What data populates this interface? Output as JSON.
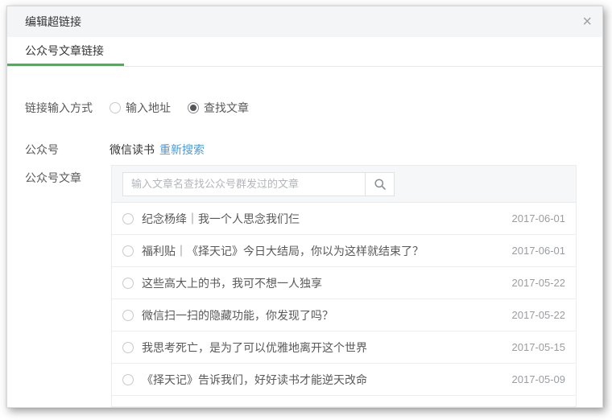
{
  "dialog": {
    "title": "编辑超链接",
    "close_icon": "×"
  },
  "tabs": {
    "article_link": "公众号文章链接"
  },
  "form": {
    "method": {
      "label": "链接输入方式",
      "options": [
        {
          "label": "输入地址",
          "selected": false
        },
        {
          "label": "查找文章",
          "selected": true
        }
      ]
    },
    "account": {
      "label": "公众号",
      "value": "微信读书",
      "research_link": "重新搜索"
    },
    "articles": {
      "label": "公众号文章",
      "search_placeholder": "输入文章名查找公众号群发过的文章",
      "rows": [
        {
          "title": "纪念杨绛｜我一个人思念我们仨",
          "date": "2017-06-01"
        },
        {
          "title": "福利贴｜《择天记》今日大结局，你以为这样就结束了？",
          "date": "2017-06-01"
        },
        {
          "title": "这些高大上的书，我可不想一人独享",
          "date": "2017-05-22"
        },
        {
          "title": "微信扫一扫的隐藏功能，你发现了吗？",
          "date": "2017-05-22"
        },
        {
          "title": "我思考死亡，是为了可以优雅地离开这个世界",
          "date": "2017-05-15"
        },
        {
          "title": "《择天记》告诉我们，好好读书才能逆天改命",
          "date": "2017-05-09"
        }
      ]
    }
  },
  "colors": {
    "accent_green": "#44b549",
    "link_blue": "#4a9bd8",
    "header_bg": "#f4f5f7",
    "panel_bg": "#f6f7f9",
    "date_gray": "#9a9da1"
  }
}
